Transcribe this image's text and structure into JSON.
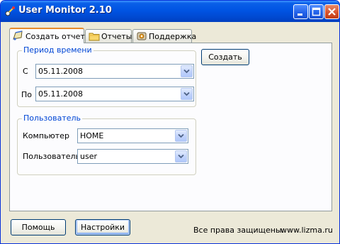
{
  "window": {
    "title": "User Monitor 2.10"
  },
  "tabs": [
    {
      "label": "Создать отчет",
      "icon": "create-report-icon",
      "active": true
    },
    {
      "label": "Отчеты",
      "icon": "folder-icon",
      "active": false
    },
    {
      "label": "Поддержка",
      "icon": "support-icon",
      "active": false
    }
  ],
  "period_group": {
    "title": "Период времени",
    "from_label": "С",
    "from_value": "05.11.2008",
    "to_label": "По",
    "to_value": "05.11.2008"
  },
  "create_button": {
    "label": "Создать"
  },
  "user_group": {
    "title": "Пользователь",
    "computer_label": "Компьютер",
    "computer_value": "HOME",
    "user_label": "Пользователь",
    "user_value": "user"
  },
  "footer": {
    "help_label": "Помощь",
    "settings_label": "Настройки",
    "copyright": "Все права защищены.",
    "website": "www.lizma.ru"
  },
  "colors": {
    "titlebar": "#0054e3",
    "group_title": "#0046d5",
    "tab_accent": "#e68b2c",
    "window_bg": "#ece9d8"
  }
}
